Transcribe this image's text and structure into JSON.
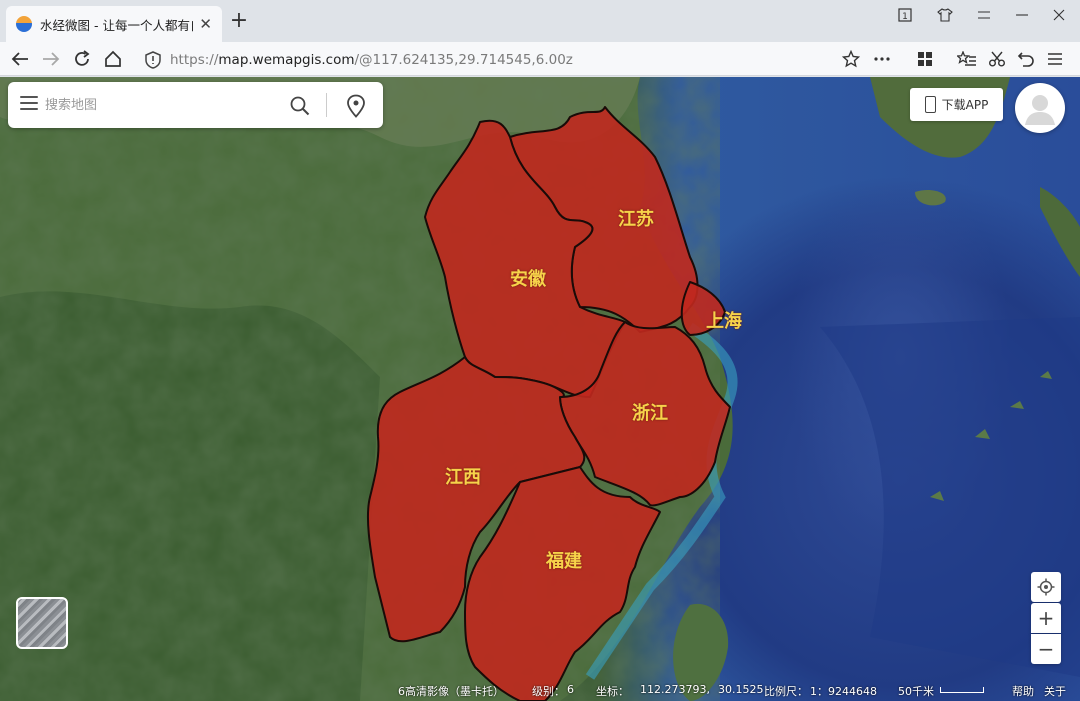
{
  "browser": {
    "tab_title": "水经微图 - 让每一个人都有自",
    "url_protocol": "https://",
    "url_host": "map.wemapgis.com",
    "url_path": "/@117.624135,29.714545,6.00z"
  },
  "search": {
    "placeholder": "搜索地图"
  },
  "download_label": "下载APP",
  "provinces": [
    "江苏",
    "安徽",
    "上海",
    "浙江",
    "江西",
    "福建"
  ],
  "zoom": {
    "in_label": "+",
    "out_label": "−"
  },
  "status": {
    "source": "6高清影像（墨卡托）",
    "level_label": "级别：",
    "level_value": "6",
    "coord_label": "坐标：",
    "lon": "112.273793,",
    "lat": "30.1525",
    "scale_label": "比例尺：",
    "scale_value": "1：9244648",
    "scale_bar": "50千米",
    "help": "帮助",
    "about": "关于"
  },
  "colors": {
    "province_fill": "#c0281e",
    "label": "#f7d34a"
  }
}
